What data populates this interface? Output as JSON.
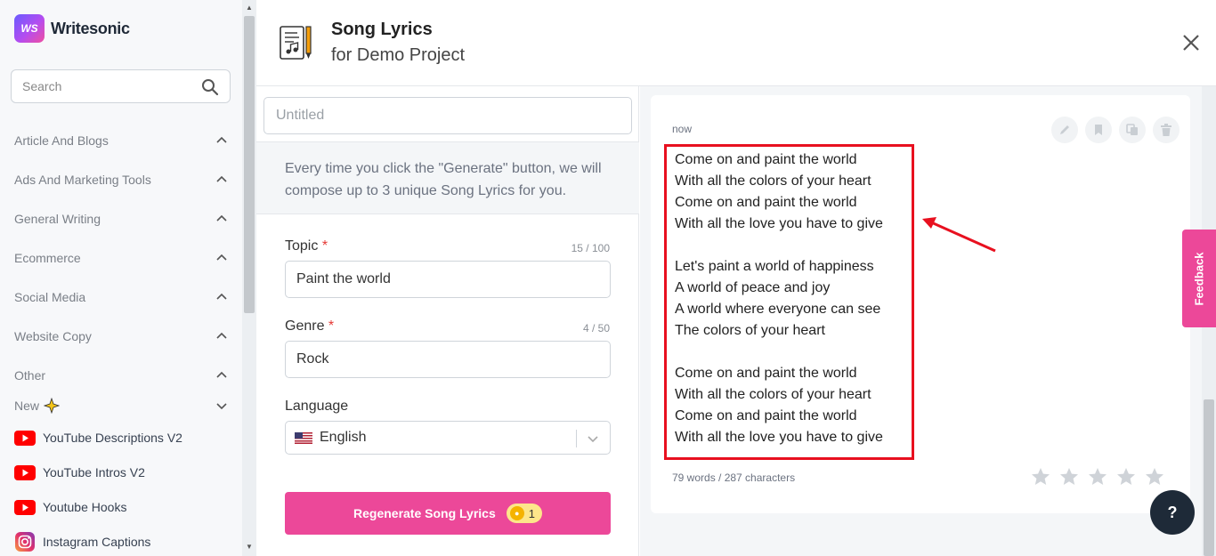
{
  "brand": {
    "logo_mark": "WS",
    "name": "Writesonic"
  },
  "sidebar": {
    "search_placeholder": "Search",
    "categories": [
      {
        "label": "Article And Blogs",
        "icon": "chevron-up-icon"
      },
      {
        "label": "Ads And Marketing Tools",
        "icon": "chevron-up-icon"
      },
      {
        "label": "General Writing",
        "icon": "chevron-up-icon"
      },
      {
        "label": "Ecommerce",
        "icon": "chevron-up-icon"
      },
      {
        "label": "Social Media",
        "icon": "chevron-up-icon"
      },
      {
        "label": "Website Copy",
        "icon": "chevron-up-icon"
      },
      {
        "label": "Other",
        "icon": "chevron-up-icon"
      },
      {
        "label": "New",
        "icon": "chevron-down-icon",
        "badge": "sparkle-icon"
      }
    ],
    "tools": [
      {
        "label": "YouTube Descriptions V2",
        "icon": "youtube-icon"
      },
      {
        "label": "YouTube Intros V2",
        "icon": "youtube-icon"
      },
      {
        "label": "Youtube Hooks",
        "icon": "youtube-icon"
      },
      {
        "label": "Instagram Captions",
        "icon": "instagram-icon"
      }
    ]
  },
  "header": {
    "title": "Song Lyrics",
    "subtitle": "for Demo Project",
    "icon": "song-lyrics-icon"
  },
  "form": {
    "title_placeholder": "Untitled",
    "info_text": "Every time you click the \"Generate\" button, we will compose up to 3 unique Song Lyrics for you.",
    "topic": {
      "label": "Topic",
      "required_mark": "*",
      "counter": "15 / 100",
      "value": "Paint the world"
    },
    "genre": {
      "label": "Genre",
      "required_mark": "*",
      "counter": "4 / 50",
      "value": "Rock"
    },
    "language": {
      "label": "Language",
      "value": "English",
      "icon": "us-flag-icon"
    },
    "regenerate_button": "Regenerate Song Lyrics",
    "credits": "1"
  },
  "output": {
    "time": "now",
    "actions": [
      "edit-icon",
      "bookmark-icon",
      "copy-icon",
      "delete-icon"
    ],
    "lyrics": [
      "Come on and paint the world",
      "With all the colors of your heart",
      "Come on and paint the world",
      "With all the love you have to give",
      "",
      "Let's paint a world of happiness",
      "A world of peace and joy",
      "A world where everyone can see",
      "The colors of your heart",
      "",
      "Come on and paint the world",
      "With all the colors of your heart",
      "Come on and paint the world",
      "With all the love you have to give"
    ],
    "stats": "79 words / 287 characters",
    "rating": {
      "stars": 5,
      "selected": 0
    }
  },
  "feedback_label": "Feedback",
  "help_label": "?",
  "colors": {
    "accent_pink": "#ec4899",
    "highlight_red": "#e8101f",
    "help_dark": "#1e2a38"
  }
}
